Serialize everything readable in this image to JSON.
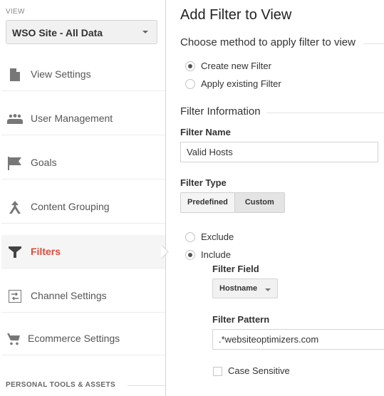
{
  "sidebar": {
    "view_label": "VIEW",
    "view_select": "WSO Site - All Data",
    "items": [
      {
        "label": "View Settings",
        "icon": "document-icon"
      },
      {
        "label": "User Management",
        "icon": "users-icon"
      },
      {
        "label": "Goals",
        "icon": "flag-icon"
      },
      {
        "label": "Content Grouping",
        "icon": "content-grouping-icon"
      },
      {
        "label": "Filters",
        "icon": "filter-icon",
        "active": true
      },
      {
        "label": "Channel Settings",
        "icon": "channel-settings-icon"
      },
      {
        "label": "Ecommerce Settings",
        "icon": "cart-icon"
      }
    ],
    "section_footer": "PERSONAL TOOLS & ASSETS"
  },
  "main": {
    "title": "Add Filter to View",
    "method_section": "Choose method to apply filter to view",
    "method_options": [
      {
        "label": "Create new Filter",
        "checked": true
      },
      {
        "label": "Apply existing Filter",
        "checked": false
      }
    ],
    "info_section": "Filter Information",
    "filter_name_label": "Filter Name",
    "filter_name_value": "Valid Hosts",
    "filter_type_label": "Filter Type",
    "filter_type_tabs": [
      {
        "label": "Predefined",
        "active": false
      },
      {
        "label": "Custom",
        "active": true
      }
    ],
    "mode_options": [
      {
        "label": "Exclude",
        "checked": false
      },
      {
        "label": "Include",
        "checked": true
      }
    ],
    "filter_field_label": "Filter Field",
    "filter_field_value": "Hostname",
    "filter_pattern_label": "Filter Pattern",
    "filter_pattern_value": ".*websiteoptimizers.com",
    "case_sensitive_label": "Case Sensitive",
    "case_sensitive_checked": false
  },
  "colors": {
    "active_nav": "#dd4b39",
    "active_bg": "#f5f5f5"
  }
}
